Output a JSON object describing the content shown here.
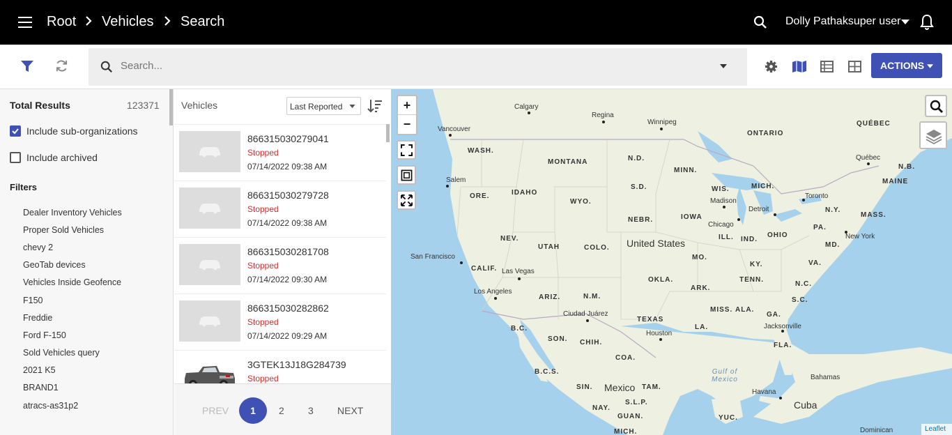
{
  "header": {
    "breadcrumbs": [
      "Root",
      "Vehicles",
      "Search"
    ],
    "user": "Dolly Pathaksuper user"
  },
  "toolbar": {
    "search_placeholder": "Search...",
    "actions_label": "ACTIONS"
  },
  "sidebar": {
    "total_label": "Total Results",
    "total_value": "123371",
    "include_sub": "Include sub-organizations",
    "include_sub_checked": true,
    "include_archived": "Include archived",
    "include_archived_checked": false,
    "filters_heading": "Filters",
    "filters": [
      "Dealer Inventory Vehicles",
      "Proper Sold Vehicles",
      "chevy 2",
      "GeoTab devices",
      "Vehicles Inside Geofence",
      "F150",
      "Freddie",
      "Ford F-150",
      "Sold Vehicles query",
      "2021 K5",
      "BRAND1",
      "atracs-as31p2"
    ]
  },
  "vehicles": {
    "heading": "Vehicles",
    "sort_label": "Last Reported",
    "items": [
      {
        "id": "866315030279041",
        "status": "Stopped",
        "date": "07/14/2022 09:38 AM"
      },
      {
        "id": "866315030279728",
        "status": "Stopped",
        "date": "07/14/2022 09:38 AM"
      },
      {
        "id": "866315030281708",
        "status": "Stopped",
        "date": "07/14/2022 09:30 AM"
      },
      {
        "id": "866315030282862",
        "status": "Stopped",
        "date": "07/14/2022 09:29 AM"
      },
      {
        "id": "3GTEK13J18G284739",
        "status": "Stopped",
        "date": ""
      }
    ],
    "pager": {
      "prev": "PREV",
      "pages": [
        "1",
        "2",
        "3"
      ],
      "next": "NEXT"
    }
  },
  "map": {
    "attribution": "Leaflet",
    "zoom_in": "+",
    "zoom_out": "−",
    "cities": [
      "Calgary",
      "Regina",
      "Winnipeg",
      "Vancouver",
      "Salem",
      "San Francisco",
      "Las Vegas",
      "Los Angeles",
      "Ciudad Juárez",
      "Houston",
      "Jacksonville",
      "Madison",
      "Chicago",
      "Detroit",
      "Toronto",
      "Québec",
      "New York",
      "Havana",
      "Dominican"
    ],
    "regions": [
      "ONTARIO",
      "QUÉBEC",
      "WASH.",
      "MONTANA",
      "N.D.",
      "MINN.",
      "N.B.",
      "MAINE",
      "ORE.",
      "IDAHO",
      "WYO.",
      "S.D.",
      "WIS.",
      "MICH.",
      "N.Y.",
      "MASS.",
      "IOWA",
      "NEBR.",
      "PA.",
      "NEV.",
      "UTAH",
      "COLO.",
      "ILL.",
      "IND.",
      "OHIO",
      "MD.",
      "CALIF.",
      "MO.",
      "KY.",
      "VA.",
      "OKLA.",
      "TENN.",
      "N.C.",
      "ARIZ.",
      "N.M.",
      "ARK.",
      "S.C.",
      "MISS.",
      "ALA.",
      "GA.",
      "TEXAS",
      "LA.",
      "B.C.",
      "SON.",
      "CHIH.",
      "FLA.",
      "COA.",
      "B.C.S.",
      "SIN.",
      "TAM.",
      "NAY.",
      "S.L.P.",
      "GUAN.",
      "YUC.",
      "MICH.",
      "Bahamas"
    ],
    "country_us": "United States",
    "country_mx": "Mexico",
    "country_cu": "Cuba",
    "gulf": "Gulf of Mexico"
  }
}
